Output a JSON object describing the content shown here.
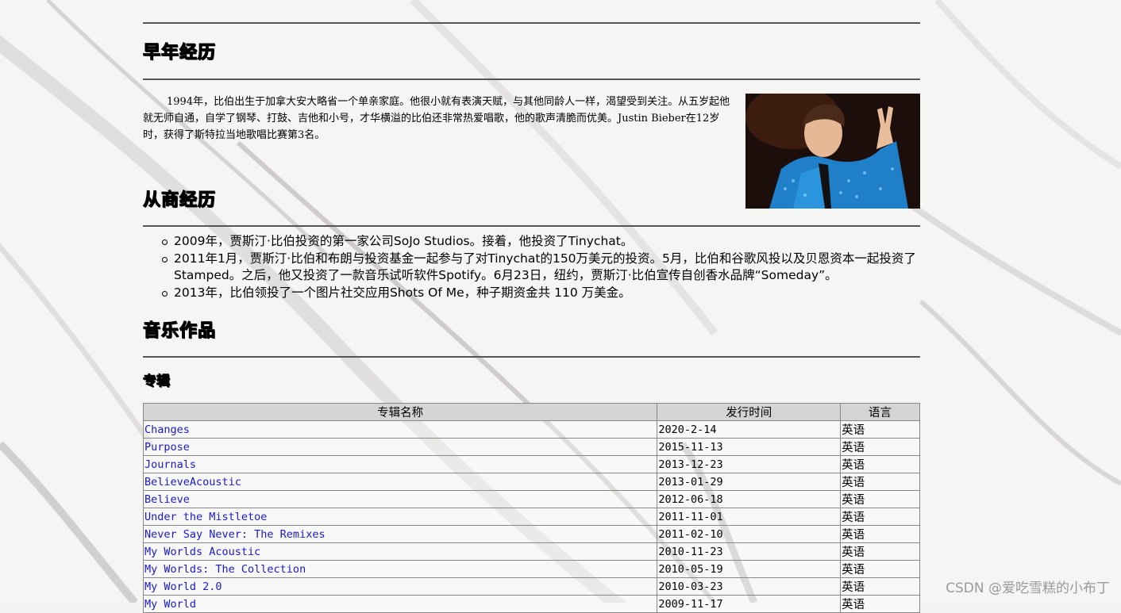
{
  "sections": {
    "early": {
      "heading": "早年经历",
      "text": "1994年，比伯出生于加拿大安大略省一个单亲家庭。他很小就有表演天赋，与其他同龄人一样，渴望受到关注。从五岁起他就无师自通，自学了钢琴、打鼓、吉他和小号，才华横溢的比伯还非常热爱唱歌，他的歌声清脆而优美。Justin Bieber在12岁时，获得了斯特拉当地歌唱比赛第3名。"
    },
    "business": {
      "heading": "从商经历",
      "items": [
        "2009年，贾斯汀·比伯投资的第一家公司SoJo Studios。接着，他投资了Tinychat。",
        "2011年1月，贾斯汀·比伯和布朗与投资基金一起参与了对Tinychat的150万美元的投资。5月，比伯和谷歌风投以及贝恩资本一起投资了Stamped。之后，他又投资了一款音乐试听软件Spotify。6月23日，纽约，贾斯汀·比伯宣传自创香水品牌“Someday”。",
        "2013年，比伯领投了一个图片社交应用Shots Of Me，种子期资金共 110 万美金。"
      ]
    },
    "music": {
      "heading": "音乐作品",
      "subheading": "专辑",
      "table": {
        "headers": [
          "专辑名称",
          "发行时间",
          "语言"
        ],
        "rows": [
          {
            "name": "Changes",
            "date": "2020-2-14",
            "lang": "英语"
          },
          {
            "name": "Purpose",
            "date": "2015-11-13",
            "lang": "英语"
          },
          {
            "name": "Journals",
            "date": "2013-12-23",
            "lang": "英语"
          },
          {
            "name": "BelieveAcoustic",
            "date": "2013-01-29",
            "lang": "英语"
          },
          {
            "name": "Believe",
            "date": "2012-06-18",
            "lang": "英语"
          },
          {
            "name": "Under the Mistletoe",
            "date": "2011-11-01",
            "lang": "英语"
          },
          {
            "name": "Never Say Never:  The Remixes",
            "date": "2011-02-10",
            "lang": "英语"
          },
          {
            "name": "My Worlds Acoustic",
            "date": "2010-11-23",
            "lang": "英语"
          },
          {
            "name": "My Worlds:  The Collection",
            "date": "2010-05-19",
            "lang": "英语"
          },
          {
            "name": "My World 2.0",
            "date": "2010-03-23",
            "lang": "英语"
          },
          {
            "name": "My World",
            "date": "2009-11-17",
            "lang": "英语"
          }
        ]
      }
    }
  },
  "watermark": "CSDN @爱吃雪糕的小布丁",
  "colors": {
    "link": "#1a1acc",
    "table_header_bg": "#d4d4d4",
    "rule": "#555555"
  }
}
